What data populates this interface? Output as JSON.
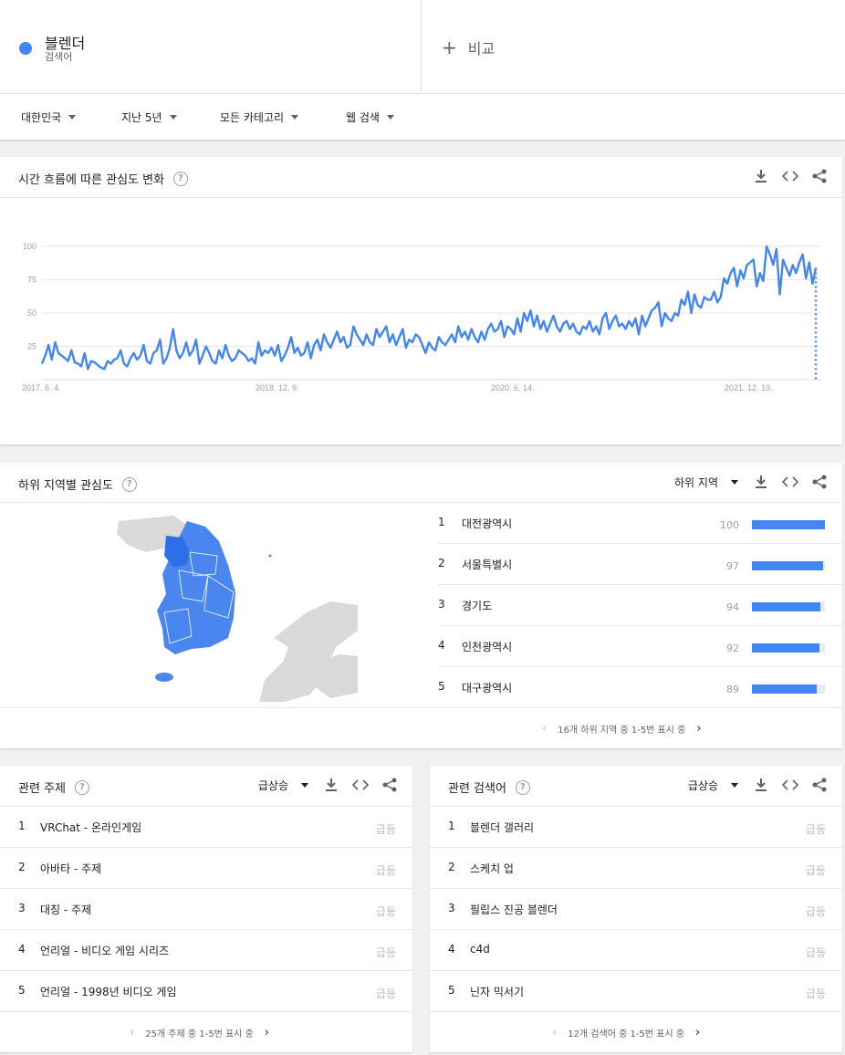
{
  "term": {
    "name": "블렌더",
    "sub": "검색어",
    "color": "#4285f4"
  },
  "compare": {
    "label": "비교"
  },
  "filters": [
    {
      "label": "대한민국"
    },
    {
      "label": "지난 5년"
    },
    {
      "label": "모든 카테고리"
    },
    {
      "label": "웹 검색"
    }
  ],
  "interest": {
    "title": "시간 흐름에 따른 관심도 변화",
    "help": "?"
  },
  "chart_data": {
    "type": "line",
    "x_tick_labels": [
      "2017. 6. 4.",
      "2018. 12. 9.",
      "2020. 6. 14.",
      "2021. 12. 19."
    ],
    "y_ticks": [
      25,
      50,
      75,
      100
    ],
    "ylim": [
      0,
      100
    ],
    "series": [
      {
        "color": "#4285f4",
        "values": [
          12,
          18,
          26,
          15,
          28,
          20,
          18,
          16,
          14,
          22,
          13,
          12,
          10,
          20,
          8,
          14,
          13,
          11,
          9,
          8,
          14,
          12,
          15,
          16,
          22,
          12,
          10,
          16,
          20,
          15,
          18,
          26,
          14,
          12,
          20,
          22,
          30,
          12,
          16,
          24,
          38,
          22,
          16,
          20,
          28,
          18,
          22,
          30,
          12,
          18,
          25,
          20,
          14,
          12,
          22,
          16,
          26,
          18,
          14,
          16,
          22,
          20,
          18,
          14,
          16,
          12,
          28,
          18,
          22,
          20,
          24,
          18,
          26,
          14,
          18,
          24,
          32,
          20,
          24,
          18,
          20,
          28,
          16,
          26,
          30,
          22,
          34,
          28,
          24,
          30,
          36,
          28,
          32,
          24,
          26,
          40,
          34,
          30,
          26,
          34,
          28,
          26,
          38,
          32,
          36,
          40,
          28,
          34,
          26,
          32,
          38,
          24,
          30,
          28,
          34,
          32,
          26,
          20,
          28,
          24,
          22,
          32,
          28,
          26,
          30,
          34,
          28,
          40,
          32,
          36,
          30,
          38,
          32,
          28,
          36,
          30,
          38,
          42,
          36,
          38,
          44,
          32,
          40,
          38,
          34,
          46,
          36,
          50,
          44,
          52,
          40,
          48,
          38,
          44,
          36,
          42,
          48,
          40,
          36,
          42,
          44,
          38,
          42,
          36,
          34,
          40,
          38,
          44,
          36,
          40,
          34,
          46,
          50,
          38,
          44,
          48,
          40,
          42,
          38,
          44,
          40,
          46,
          34,
          48,
          40,
          46,
          52,
          54,
          58,
          40,
          50,
          46,
          44,
          50,
          48,
          60,
          56,
          66,
          50,
          64,
          56,
          54,
          62,
          60,
          60,
          66,
          58,
          62,
          76,
          72,
          80,
          84,
          70,
          82,
          76,
          86,
          88,
          90,
          70,
          80,
          74,
          100,
          94,
          86,
          98,
          64,
          90,
          84,
          78,
          86,
          80,
          88,
          94,
          76,
          88,
          72,
          84
        ]
      }
    ]
  },
  "subregion": {
    "title": "하위 지역별 관심도",
    "help": "?",
    "selector": "하위 지역",
    "rows": [
      {
        "rank": "1",
        "name": "대전광역시",
        "value": 100
      },
      {
        "rank": "2",
        "name": "서울특별시",
        "value": 97
      },
      {
        "rank": "3",
        "name": "경기도",
        "value": 94
      },
      {
        "rank": "4",
        "name": "인천광역시",
        "value": 92
      },
      {
        "rank": "5",
        "name": "대구광역시",
        "value": 89
      }
    ],
    "pager": "16개 하위 지역 중 1-5번 표시 중"
  },
  "topics": {
    "title": "관련 주제",
    "help": "?",
    "selector": "급상승",
    "rows": [
      {
        "rank": "1",
        "name": "VRChat - 온라인게임",
        "status": "급등"
      },
      {
        "rank": "2",
        "name": "아바타 - 주제",
        "status": "급등"
      },
      {
        "rank": "3",
        "name": "대칭 - 주제",
        "status": "급등"
      },
      {
        "rank": "4",
        "name": "언리얼 - 비디오 게임 시리즈",
        "status": "급등"
      },
      {
        "rank": "5",
        "name": "언리얼 - 1998년 비디오 게임",
        "status": "급등"
      }
    ],
    "pager": "25개 주제 중 1-5번 표시 중"
  },
  "queries": {
    "title": "관련 검색어",
    "help": "?",
    "selector": "급상승",
    "rows": [
      {
        "rank": "1",
        "name": "블렌더 갤러리",
        "status": "급등"
      },
      {
        "rank": "2",
        "name": "스케치 업",
        "status": "급등"
      },
      {
        "rank": "3",
        "name": "필립스 진공 블렌더",
        "status": "급등"
      },
      {
        "rank": "4",
        "name": "c4d",
        "status": "급등"
      },
      {
        "rank": "5",
        "name": "닌자 믹서기",
        "status": "급등"
      }
    ],
    "pager": "12개 검색어 중 1-5번 표시 중"
  },
  "icons": {
    "download": "download-icon",
    "embed": "embed-icon",
    "share": "share-icon",
    "help": "help-icon"
  }
}
